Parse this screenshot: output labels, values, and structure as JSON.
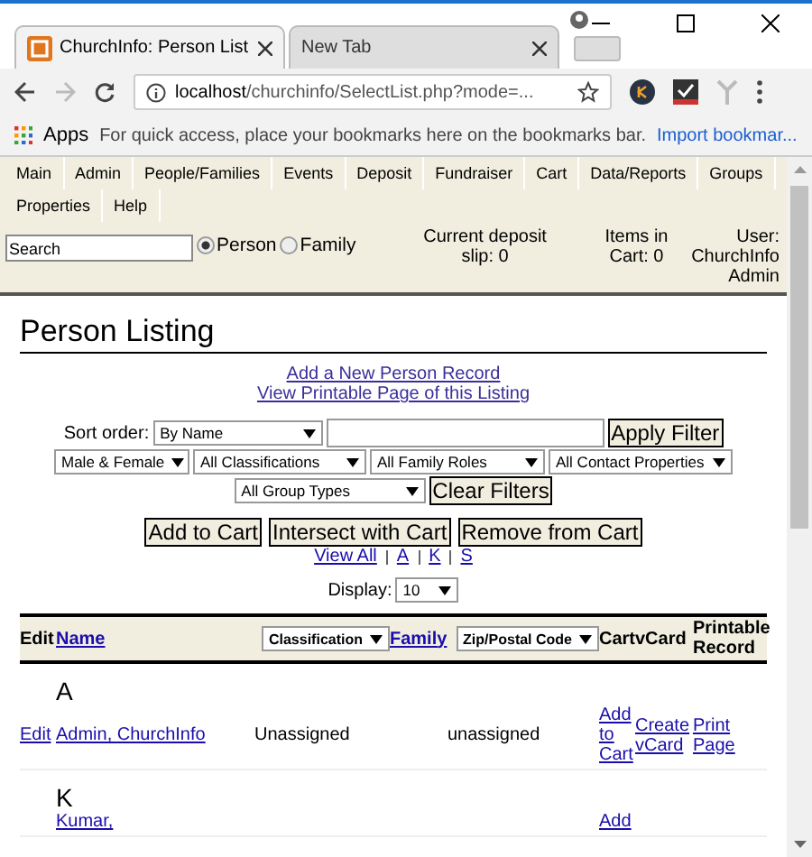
{
  "browser": {
    "tabs": [
      {
        "title": "ChurchInfo: Person List",
        "selected": true
      },
      {
        "title": "New Tab",
        "selected": false
      }
    ],
    "address": {
      "host": "localhost",
      "path": "/churchinfo/SelectList.php?mode=..."
    },
    "bookmarks": {
      "apps": "Apps",
      "message": "For quick access, place your bookmarks here on the bookmarks bar.",
      "link": "Import bookmar..."
    }
  },
  "menu": [
    "Main",
    "Admin",
    "People/Families",
    "Events",
    "Deposit",
    "Fundraiser",
    "Cart",
    "Data/Reports",
    "Groups",
    "Properties",
    "Help"
  ],
  "search": {
    "value": "Search",
    "options": [
      {
        "label": "Person",
        "selected": true
      },
      {
        "label": "Family",
        "selected": false
      }
    ]
  },
  "status": {
    "deposit": "Current deposit slip: 0",
    "cart": "Items in Cart: 0",
    "user": "User: ChurchInfo Admin"
  },
  "heading": "Person Listing",
  "links": [
    "Add a New Person Record",
    "View Printable Page of this Listing"
  ],
  "filters": {
    "sort_label": "Sort order:",
    "sort": "By Name",
    "apply": "Apply Filter",
    "selects": [
      "Male & Female",
      "All Classifications",
      "All Family Roles",
      "All Contact Properties",
      "All Group Types"
    ],
    "clear": "Clear Filters"
  },
  "actions": [
    "Add to Cart",
    "Intersect with Cart",
    "Remove from Cart"
  ],
  "letters": [
    "View All",
    "A",
    "K",
    "S"
  ],
  "display": {
    "label": "Display:",
    "value": "10"
  },
  "table": {
    "columns": [
      {
        "label": "Edit",
        "kind": "text"
      },
      {
        "label": "Name",
        "kind": "link"
      },
      {
        "label": "Classification",
        "kind": "select"
      },
      {
        "label": "Family",
        "kind": "link"
      },
      {
        "label": "Zip/Postal Code",
        "kind": "select"
      },
      {
        "label": "Cart",
        "kind": "text"
      },
      {
        "label": "vCard",
        "kind": "text"
      },
      {
        "label": "Printable Record",
        "kind": "text"
      }
    ],
    "groups": [
      {
        "letter": "A",
        "rows": [
          {
            "edit": "Edit",
            "name": "Admin, ChurchInfo",
            "classification": "Unassigned",
            "zip": "unassigned",
            "cart": "Add to Cart",
            "vcard": "Create vCard",
            "print": "Print Page"
          }
        ]
      },
      {
        "letter": "K",
        "rows": [
          {
            "name": "Kumar,",
            "cart": "Add"
          }
        ]
      }
    ]
  }
}
